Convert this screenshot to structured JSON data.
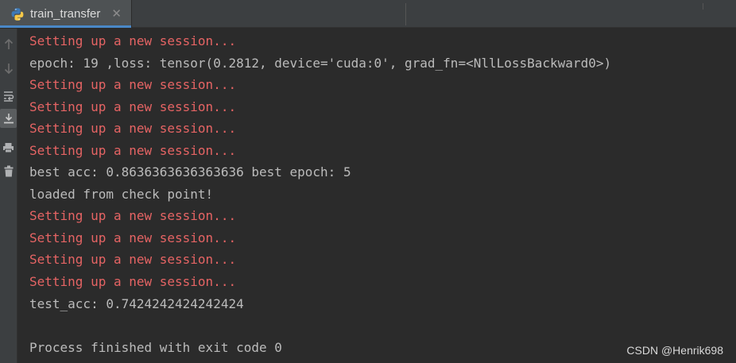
{
  "tab": {
    "title": "train_transfer",
    "close_glyph": "✕",
    "icon": "python-file-icon"
  },
  "toolbar": {
    "buttons": [
      {
        "name": "scroll-up-arrow-icon",
        "glyph": "↑"
      },
      {
        "name": "scroll-down-arrow-icon",
        "glyph": "↓"
      },
      {
        "name": "soft-wrap-icon",
        "glyph": "wrap"
      },
      {
        "name": "scroll-to-end-icon",
        "glyph": "end",
        "active": true
      },
      {
        "name": "print-icon",
        "glyph": "print"
      },
      {
        "name": "clear-all-icon",
        "glyph": "trash"
      }
    ]
  },
  "console": {
    "lines": [
      {
        "text": "Setting up a new session...",
        "kind": "err"
      },
      {
        "text": "epoch: 19 ,loss: tensor(0.2812, device='cuda:0', grad_fn=<NllLossBackward0>)",
        "kind": "out"
      },
      {
        "text": "Setting up a new session...",
        "kind": "err"
      },
      {
        "text": "Setting up a new session...",
        "kind": "err"
      },
      {
        "text": "Setting up a new session...",
        "kind": "err"
      },
      {
        "text": "Setting up a new session...",
        "kind": "err"
      },
      {
        "text": "best acc: 0.8636363636363636 best epoch: 5",
        "kind": "out"
      },
      {
        "text": "loaded from check point!",
        "kind": "out"
      },
      {
        "text": "Setting up a new session...",
        "kind": "err"
      },
      {
        "text": "Setting up a new session...",
        "kind": "err"
      },
      {
        "text": "Setting up a new session...",
        "kind": "err"
      },
      {
        "text": "Setting up a new session...",
        "kind": "err"
      },
      {
        "text": "test_acc: 0.7424242424242424",
        "kind": "out"
      },
      {
        "text": "",
        "kind": "out"
      },
      {
        "text": "Process finished with exit code 0",
        "kind": "out"
      }
    ]
  },
  "watermark": "CSDN @Henrik698",
  "colors": {
    "background": "#2b2b2b",
    "error_text": "#e66464",
    "normal_text": "#bbbbbb",
    "tab_accent": "#4a88c7"
  }
}
